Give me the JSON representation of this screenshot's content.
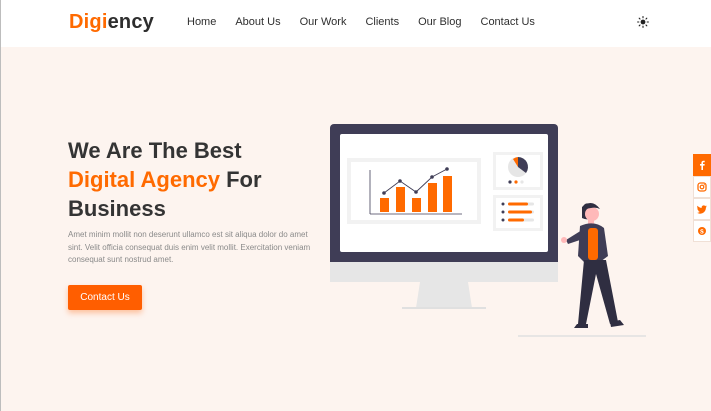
{
  "header": {
    "logo_accent": "Digi",
    "logo_rest": "ency",
    "nav": [
      "Home",
      "About Us",
      "Our Work",
      "Clients",
      "Our Blog",
      "Contact Us"
    ],
    "theme_toggle_icon": "sun-icon"
  },
  "hero": {
    "title_line1": "We Are The Best",
    "title_accent": "Digital Agency",
    "title_after_accent": " For",
    "title_line3": "Business",
    "description": "Amet minim mollit non deserunt ullamco est sit aliqua dolor do amet sint. Velit officia consequat duis enim velit mollit. Exercitation veniam consequat sunt nostrud amet.",
    "cta_label": "Contact Us"
  },
  "social": [
    "facebook-icon",
    "instagram-icon",
    "twitter-icon",
    "skype-icon"
  ],
  "colors": {
    "accent": "#ff6a00",
    "hero_bg": "#fdf4ef",
    "text_dark": "#343434",
    "monitor_frame": "#3f3d56"
  }
}
